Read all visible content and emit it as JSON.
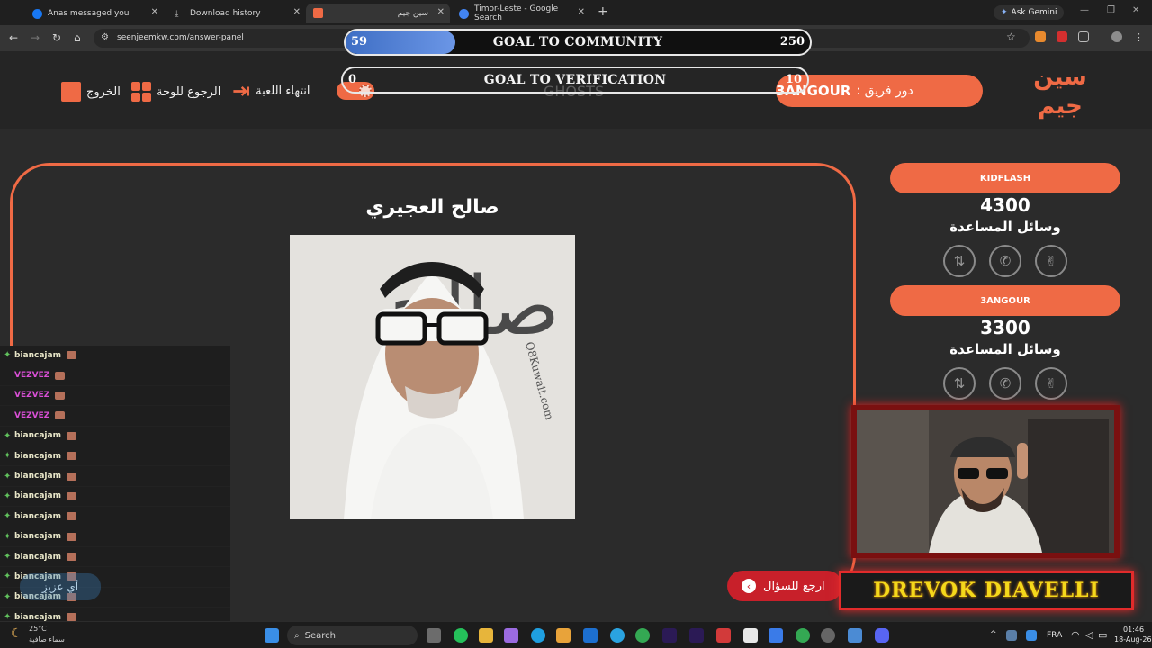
{
  "browser": {
    "tabs": [
      {
        "title": "Anas messaged you",
        "favicon": "facebook-icon",
        "color": "#1877f2"
      },
      {
        "title": "Download history",
        "favicon": "download-icon",
        "color": "#9a9a9a"
      },
      {
        "title": "سين جيم",
        "favicon": "seenjeem-icon",
        "color": "#ef6a45"
      },
      {
        "title": "Timor-Leste - Google Search",
        "favicon": "google-icon",
        "color": "#4285f4"
      }
    ],
    "gemini_label": "Ask Gemini",
    "url": "seenjeemkw.com/answer-panel"
  },
  "goals": {
    "community": {
      "title": "GOAL TO COMMUNITY",
      "current": "59",
      "target": "250",
      "progress": 0.236
    },
    "verification": {
      "title": "GOAL TO VERIFICATION",
      "current": "0",
      "target": "10",
      "progress": 0
    }
  },
  "header": {
    "exit_label": "الخروج",
    "back_board_label": "الرجوع للوحة",
    "end_game_label": "انتهاء اللعبة",
    "ghost_text": "GHOSTS",
    "turn_label": "دور فريق :",
    "turn_team": "3ANGOUR",
    "logo_line1": "سين",
    "logo_line2": "جيم"
  },
  "answer": {
    "title": "صالح العجيري",
    "watermark": "Q8Kuwait.com"
  },
  "teams": [
    {
      "name": "KIDFLASH",
      "score": "4300",
      "help_label": "وسائل المساعدة"
    },
    {
      "name": "3ANGOUR",
      "score": "3300",
      "help_label": "وسائل المساعدة"
    }
  ],
  "chat": {
    "rows": [
      {
        "user": "biancajam",
        "color": "#e8e6c8"
      },
      {
        "user": "VEZVEZ",
        "color": "#d94fd6"
      },
      {
        "user": "VEZVEZ",
        "color": "#d94fd6"
      },
      {
        "user": "VEZVEZ",
        "color": "#d94fd6"
      },
      {
        "user": "biancajam",
        "color": "#e8e6c8"
      },
      {
        "user": "biancajam",
        "color": "#e8e6c8"
      },
      {
        "user": "biancajam",
        "color": "#e8e6c8"
      },
      {
        "user": "biancajam",
        "color": "#e8e6c8"
      },
      {
        "user": "biancajam",
        "color": "#e8e6c8"
      },
      {
        "user": "biancajam",
        "color": "#e8e6c8"
      },
      {
        "user": "biancajam",
        "color": "#e8e6c8"
      },
      {
        "user": "biancajam",
        "color": "#e8e6c8"
      },
      {
        "user": "biancajam",
        "color": "#e8e6c8"
      },
      {
        "user": "biancajam",
        "color": "#e8e6c8"
      }
    ],
    "overlay_text": "أي عزيز"
  },
  "stream": {
    "streamer_name": "DREVOK DIAVELLI",
    "back_to_question_label": "ارجع للسؤال"
  },
  "taskbar": {
    "search_label": "Search",
    "weather_temp": "25°C",
    "weather_desc": "سماء صافية",
    "lang": "FRA",
    "time": "01:46",
    "date": "18-Aug-26"
  }
}
